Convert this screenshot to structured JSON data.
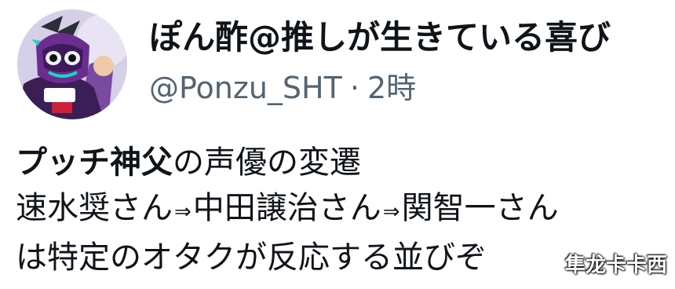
{
  "user": {
    "display_name": "ぽん酢@推しが生きている喜び",
    "handle": "@Ponzu_SHT",
    "separator": "·",
    "time": "2時"
  },
  "tweet": {
    "line1_bold": "プッチ神父",
    "line1_rest": "の声優の変遷",
    "line2_a": "速水奨さん",
    "line2_b": "中田譲治さん",
    "line2_c": "関智一さん",
    "arrow": "⇒",
    "line3": "は特定のオタクが反応する並びぞ"
  },
  "avatar_icon": "masked-hero-avatar-icon",
  "watermark": "隼龙卡卡西",
  "colors": {
    "text": "#0f1419",
    "secondary": "#536471",
    "avatar_bg": "#cfc7e4"
  }
}
